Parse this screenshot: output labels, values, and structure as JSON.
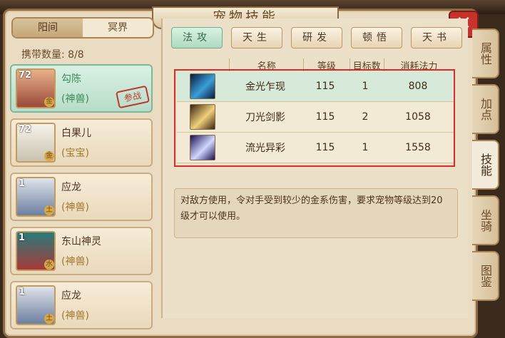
{
  "window_title": "宠物技能",
  "realm_tabs": [
    "阳间",
    "冥界"
  ],
  "carry": {
    "label": "携带数量:",
    "value": "8/8"
  },
  "pets": [
    {
      "level": "72",
      "element": "金",
      "name": "勾陈",
      "type": "(神兽)",
      "status": "参战"
    },
    {
      "level": "72",
      "element": "金",
      "name": "白果儿",
      "type": "(宝宝)"
    },
    {
      "level": "1",
      "element": "土",
      "name": "应龙",
      "type": "(神兽)"
    },
    {
      "level": "1",
      "element": "水",
      "name": "东山神灵",
      "type": "(神兽)"
    },
    {
      "level": "1",
      "element": "土",
      "name": "应龙",
      "type": "(神兽)"
    }
  ],
  "skill_tabs": [
    "法攻",
    "天生",
    "研发",
    "顿悟",
    "天书"
  ],
  "table_headers": {
    "name": "名称",
    "level": "等级",
    "targets": "目标数",
    "cost": "消耗法力"
  },
  "skills": [
    {
      "icon": "sword-slash-icon",
      "name": "金光乍现",
      "level": "115",
      "targets": "1",
      "cost": "808"
    },
    {
      "icon": "blade-shadow-icon",
      "name": "刀光剑影",
      "level": "115",
      "targets": "2",
      "cost": "1058"
    },
    {
      "icon": "flowing-light-icon",
      "name": "流光异彩",
      "level": "115",
      "targets": "1",
      "cost": "1558"
    }
  ],
  "description": "对敌方使用，令对手受到较少的金系伤害，要求宠物等级达到20级才可以使用。",
  "side_tabs": [
    "属性",
    "加点",
    "技能",
    "坐骑",
    "图鉴"
  ],
  "close_icon": "close-icon"
}
